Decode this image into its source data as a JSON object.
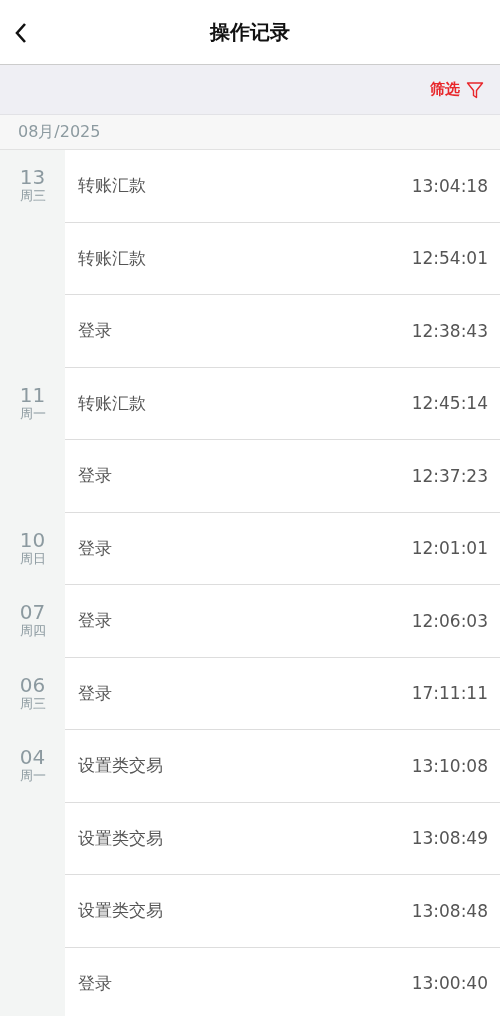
{
  "header": {
    "title": "操作记录"
  },
  "filter": {
    "label": "筛选"
  },
  "month": "08月/2025",
  "groups": [
    {
      "day": "13",
      "weekday": "周三",
      "records": [
        {
          "action": "转账汇款",
          "time": "13:04:18"
        },
        {
          "action": "转账汇款",
          "time": "12:54:01"
        },
        {
          "action": "登录",
          "time": "12:38:43"
        }
      ]
    },
    {
      "day": "11",
      "weekday": "周一",
      "records": [
        {
          "action": "转账汇款",
          "time": "12:45:14"
        },
        {
          "action": "登录",
          "time": "12:37:23"
        }
      ]
    },
    {
      "day": "10",
      "weekday": "周日",
      "records": [
        {
          "action": "登录",
          "time": "12:01:01"
        }
      ]
    },
    {
      "day": "07",
      "weekday": "周四",
      "records": [
        {
          "action": "登录",
          "time": "12:06:03"
        }
      ]
    },
    {
      "day": "06",
      "weekday": "周三",
      "records": [
        {
          "action": "登录",
          "time": "17:11:11"
        }
      ]
    },
    {
      "day": "04",
      "weekday": "周一",
      "records": [
        {
          "action": "设置类交易",
          "time": "13:10:08"
        },
        {
          "action": "设置类交易",
          "time": "13:08:49"
        },
        {
          "action": "设置类交易",
          "time": "13:08:48"
        },
        {
          "action": "登录",
          "time": "13:00:40"
        }
      ]
    }
  ]
}
